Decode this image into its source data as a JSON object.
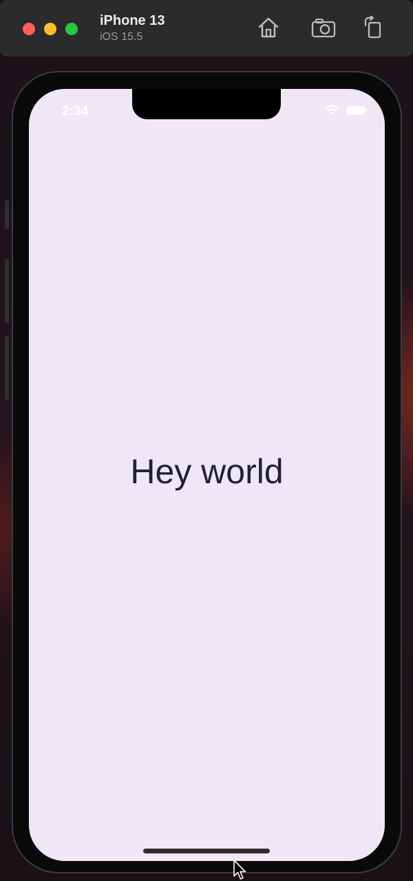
{
  "window": {
    "device_name": "iPhone 13",
    "os_version": "iOS 15.5",
    "toolbar": {
      "home_icon": "home-icon",
      "screenshot_icon": "camera-icon",
      "rotate_icon": "rotate-icon"
    }
  },
  "status_bar": {
    "time": "2:34"
  },
  "app": {
    "greeting": "Hey world"
  },
  "colors": {
    "screen_background": "#efe6f6",
    "greeting_text": "#1e2238",
    "titlebar": "#2b2b2d"
  }
}
